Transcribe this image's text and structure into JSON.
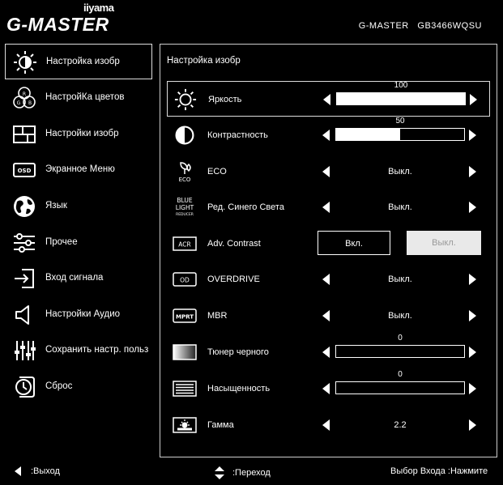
{
  "header": {
    "brand_small": "iiyama",
    "brand_large": "G-MASTER",
    "model": "G-MASTER   GB3466WQSU"
  },
  "sidebar": {
    "items": [
      {
        "label": "Настройка изобр",
        "icon": "sun-icon",
        "active": true
      },
      {
        "label": "НастройКа цветов",
        "icon": "rgb-icon",
        "active": false
      },
      {
        "label": "Настройки изобр",
        "icon": "picture-layout-icon",
        "active": false
      },
      {
        "label": "Экранное Меню",
        "icon": "osd-icon",
        "active": false
      },
      {
        "label": "Язык",
        "icon": "globe-icon",
        "active": false
      },
      {
        "label": "Прочее",
        "icon": "sliders-icon",
        "active": false
      },
      {
        "label": "Вход сигнала",
        "icon": "input-icon",
        "active": false
      },
      {
        "label": "Настройки Аудио",
        "icon": "speaker-icon",
        "active": false
      },
      {
        "label": "Сохранить настр. польз",
        "icon": "equalizer-icon",
        "active": false
      },
      {
        "label": "Сброс",
        "icon": "reset-clock-icon",
        "active": false
      }
    ]
  },
  "panel": {
    "title": "Настройка изобр",
    "rows": [
      {
        "label": "Яркость",
        "icon": "sun-icon",
        "type": "slider",
        "value": "100",
        "fraction": 1.0
      },
      {
        "label": "Контрастность",
        "icon": "contrast-icon",
        "type": "slider",
        "value": "50",
        "fraction": 0.5
      },
      {
        "label": "ECO",
        "icon": "eco-leaf-icon",
        "icon_text": "ECO",
        "type": "option",
        "value": "Выкл."
      },
      {
        "label": "Ред. Синего Света",
        "icon": "blue-light-icon",
        "icon_text": [
          "BLUE",
          "LIGHT",
          "REDUCER"
        ],
        "type": "option",
        "value": "Выкл."
      },
      {
        "label": "Adv. Contrast",
        "icon": "acr-icon",
        "icon_text": "ACR",
        "type": "toggle",
        "on_label": "Вкл.",
        "off_label": "Выкл."
      },
      {
        "label": "OVERDRIVE",
        "icon": "od-icon",
        "icon_text": "OD",
        "type": "option",
        "value": "Выкл."
      },
      {
        "label": "MBR",
        "icon": "mprt-icon",
        "icon_text": "MPRT",
        "type": "option",
        "value": "Выкл."
      },
      {
        "label": "Тюнер черного",
        "icon": "black-tuner-icon",
        "type": "slider",
        "value": "0",
        "fraction": 0.0
      },
      {
        "label": "Насыщенность",
        "icon": "saturation-icon",
        "type": "slider",
        "value": "0",
        "fraction": 0.0
      },
      {
        "label": "Гамма",
        "icon": "gamma-icon",
        "type": "option",
        "value": "2.2"
      }
    ]
  },
  "footer": {
    "exit": ":Выход",
    "navigate": ":Переход",
    "select": "Выбор Входа :Нажмите"
  }
}
